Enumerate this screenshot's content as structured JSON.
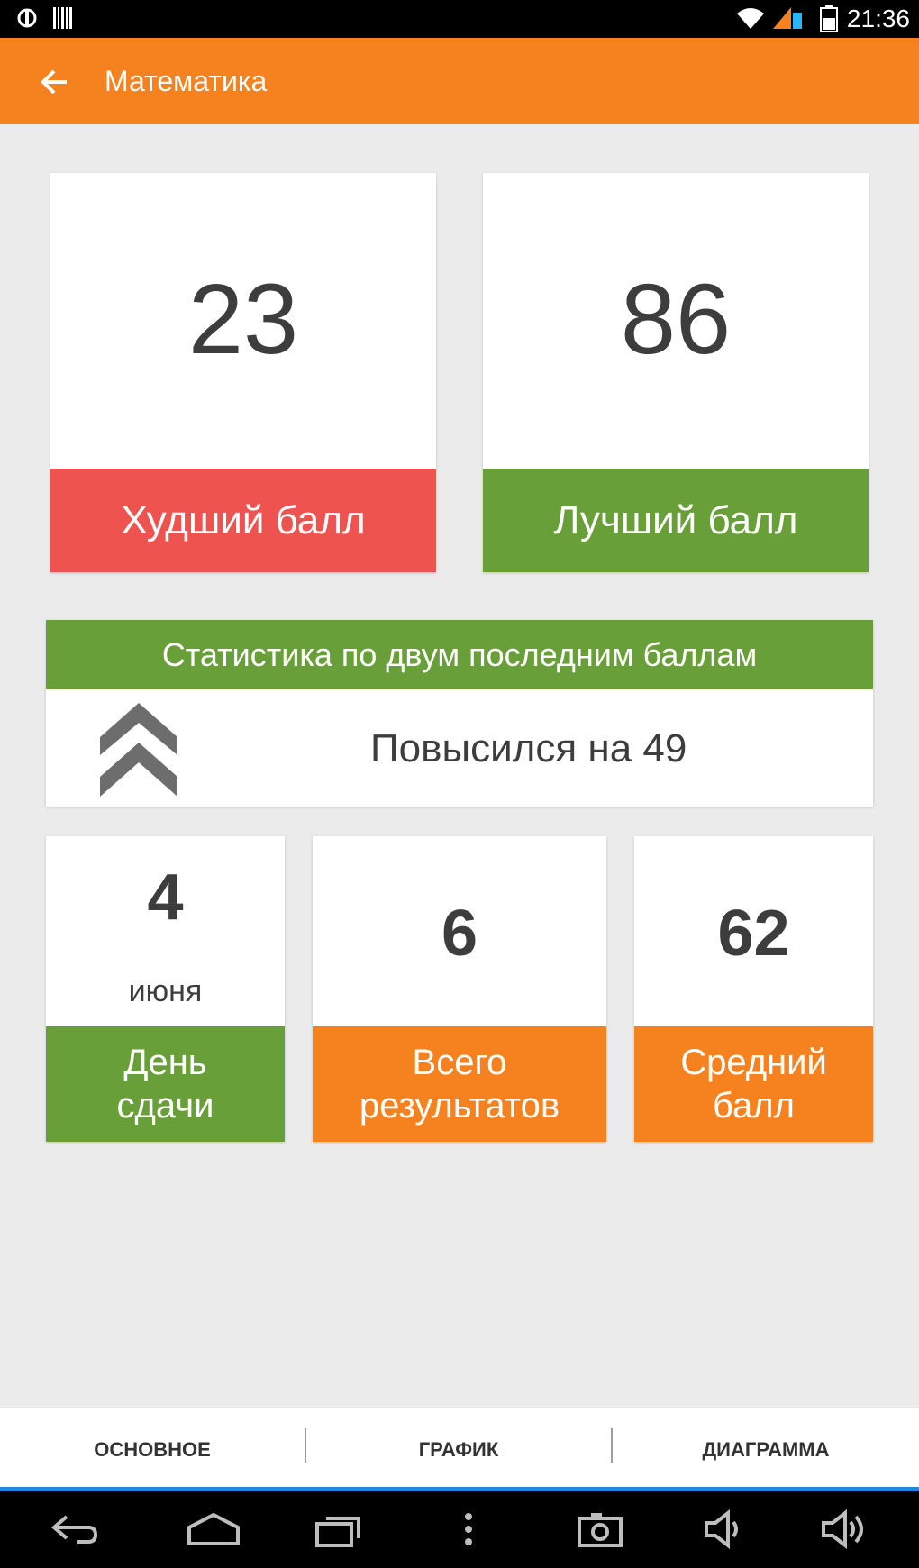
{
  "status_bar": {
    "time": "21:36",
    "icons": [
      "usb-debug-icon",
      "barcode-icon",
      "wifi-icon",
      "signal-icon",
      "battery-icon"
    ]
  },
  "app_bar": {
    "title": "Математика",
    "back_icon": "arrow-left-icon"
  },
  "score_cards": {
    "worst": {
      "value": "23",
      "label": "Худший балл"
    },
    "best": {
      "value": "86",
      "label": "Лучший балл"
    }
  },
  "last_two_stats": {
    "header": "Статистика по двум последним баллам",
    "trend_icon": "double-chevron-up-icon",
    "text": "Повысился на 49"
  },
  "summary": {
    "exam_day": {
      "value": "4",
      "sub": "июня",
      "label_line1": "День",
      "label_line2": "сдачи"
    },
    "total": {
      "value": "6",
      "label_line1": "Всего",
      "label_line2": "результатов"
    },
    "average": {
      "value": "62",
      "label_line1": "Средний",
      "label_line2": "балл"
    }
  },
  "tabs": [
    {
      "label": "ОСНОВНОЕ",
      "selected": true
    },
    {
      "label": "ГРАФИК",
      "selected": false
    },
    {
      "label": "ДИАГРАММА",
      "selected": false
    }
  ],
  "nav_bar": {
    "icons": [
      "back-icon",
      "home-icon",
      "recents-icon",
      "menu-icon",
      "screenshot-icon",
      "volume-down-icon",
      "volume-up-icon"
    ]
  },
  "colors": {
    "accent": "#f5821f",
    "worst": "#ef5350",
    "best": "#689f38",
    "tab_indicator": "#1e88e5"
  }
}
